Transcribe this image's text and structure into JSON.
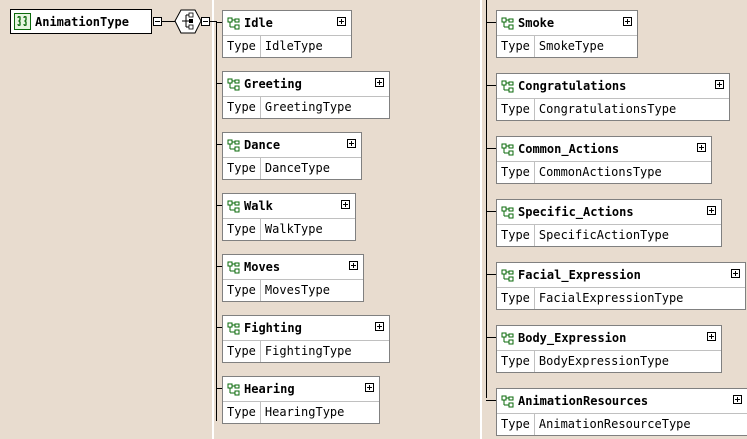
{
  "root": {
    "label": "AnimationType"
  },
  "compositor": {
    "icon": "choice-compositor-icon"
  },
  "left_children": [
    {
      "name": "Idle",
      "type_key": "Type",
      "type_value": "IdleType"
    },
    {
      "name": "Greeting",
      "type_key": "Type",
      "type_value": "GreetingType"
    },
    {
      "name": "Dance",
      "type_key": "Type",
      "type_value": "DanceType"
    },
    {
      "name": "Walk",
      "type_key": "Type",
      "type_value": "WalkType"
    },
    {
      "name": "Moves",
      "type_key": "Type",
      "type_value": "MovesType"
    },
    {
      "name": "Fighting",
      "type_key": "Type",
      "type_value": "FightingType"
    },
    {
      "name": "Hearing",
      "type_key": "Type",
      "type_value": "HearingType"
    }
  ],
  "right_children": [
    {
      "name": "Smoke",
      "type_key": "Type",
      "type_value": "SmokeType"
    },
    {
      "name": "Congratulations",
      "type_key": "Type",
      "type_value": "CongratulationsType"
    },
    {
      "name": "Common_Actions",
      "type_key": "Type",
      "type_value": "CommonActionsType"
    },
    {
      "name": "Specific_Actions",
      "type_key": "Type",
      "type_value": "SpecificActionType"
    },
    {
      "name": "Facial_Expression",
      "type_key": "Type",
      "type_value": "FacialExpressionType"
    },
    {
      "name": "Body_Expression",
      "type_key": "Type",
      "type_value": "BodyExpressionType"
    },
    {
      "name": "AnimationResources",
      "type_key": "Type",
      "type_value": "AnimationResourceType"
    }
  ],
  "colors": {
    "background": "#e8dccf",
    "node_border": "#808080",
    "icon_green": "#0a6a0a"
  }
}
